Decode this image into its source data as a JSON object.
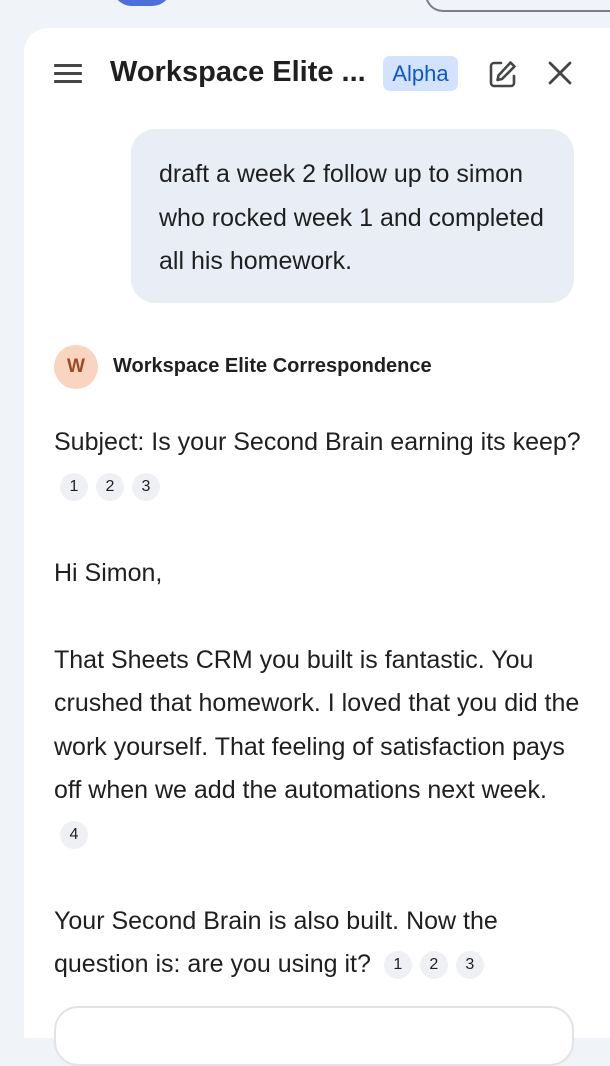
{
  "header": {
    "title": "Workspace Elite ...",
    "badge": "Alpha"
  },
  "user_message": "draft a week 2 follow up to simon who rocked week 1 and completed all his homework.",
  "assistant": {
    "avatar_letter": "W",
    "name": "Workspace Elite Correspondence"
  },
  "reply": {
    "subject": "Subject: Is your Second Brain earning its keep?",
    "subject_citations": [
      "1",
      "2",
      "3"
    ],
    "greeting": "Hi Simon,",
    "para1": "That Sheets CRM you built is fantastic. You crushed that homework. I loved that you did the work yourself. That feeling of satisfaction pays off when we add the automations next week.",
    "para1_citations": [
      "4"
    ],
    "para2": "Your Second Brain is also built. Now the question is: are you using it?",
    "para2_citations": [
      "1",
      "2",
      "3"
    ]
  },
  "colors": {
    "badge_bg": "#d3e3fd",
    "badge_text": "#0b57d0",
    "user_bubble": "#e9eef6",
    "avatar_bg": "#f9d5c0"
  }
}
